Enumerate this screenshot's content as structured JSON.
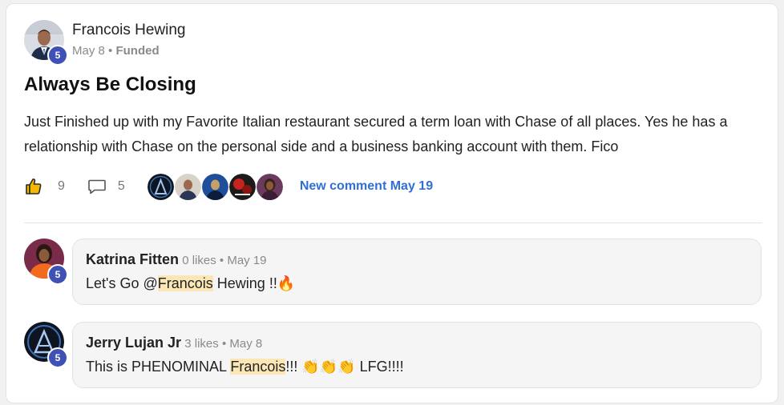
{
  "post": {
    "author": "Francois Hewing",
    "level": "5",
    "date": "May 8",
    "separator": "•",
    "category": "Funded",
    "title": "Always Be Closing",
    "body": "Just Finished up with my Favorite Italian restaurant secured a term loan with Chase of all places. Yes he has a relationship with Chase on the personal side and a business banking account with them. Fico",
    "likes": "9",
    "comments": "5",
    "new_comment_label": "New comment May 19"
  },
  "comments": [
    {
      "author": "Katrina Fitten",
      "level": "5",
      "likes_text": "0 likes",
      "separator": "•",
      "date": "May 19",
      "text_before": "Let's Go @",
      "mention": "Francois",
      "text_after": " Hewing !!🔥"
    },
    {
      "author": "Jerry Lujan Jr",
      "level": "5",
      "likes_text": "3 likes",
      "separator": "•",
      "date": "May 8",
      "text_before": "This is PHENOMINAL ",
      "mention": "Francois",
      "text_after": "!!! 👏👏👏 LFG!!!!"
    }
  ],
  "icons": {
    "like": "thumbs-up-icon",
    "comment": "comment-bubble-icon"
  },
  "colors": {
    "level_badge": "#3f51b5",
    "link": "#2f6fd8",
    "mention_highlight": "#fbe7b5"
  }
}
